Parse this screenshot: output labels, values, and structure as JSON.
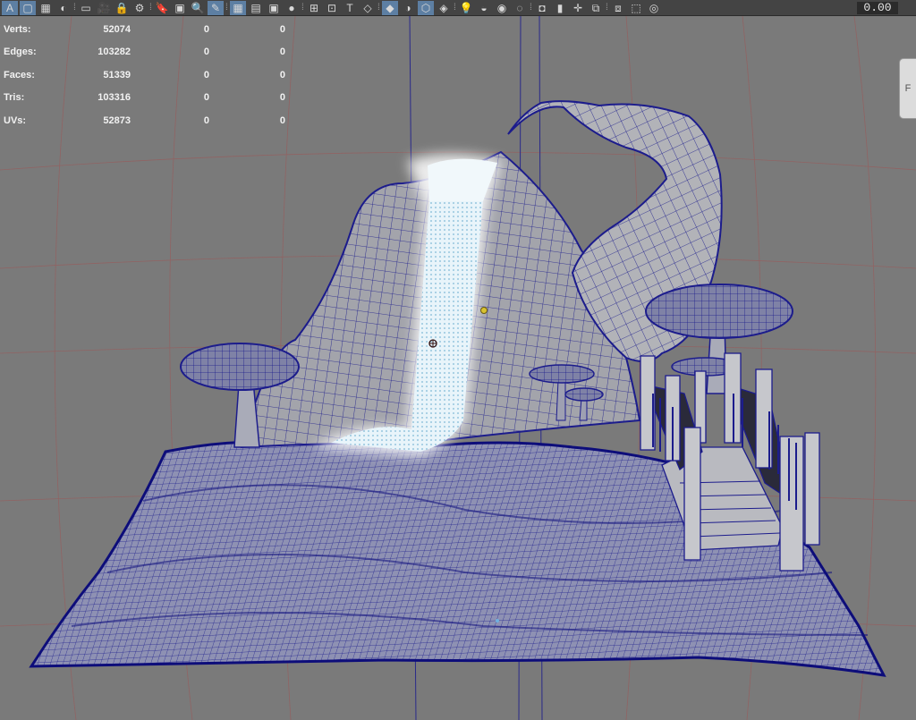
{
  "toolbar": {
    "icons": [
      {
        "name": "select-camera-icon",
        "glyph": "A",
        "active": true
      },
      {
        "name": "viewport-layout-icon",
        "glyph": "▢",
        "active": true
      },
      {
        "name": "panel-layout-icon",
        "glyph": "▦",
        "active": false
      },
      {
        "name": "ui-element-icon",
        "glyph": "◐",
        "active": false
      },
      {
        "name": "film-icon",
        "glyph": "▭",
        "active": false
      },
      {
        "name": "camera-icon",
        "glyph": "🎥",
        "active": false
      },
      {
        "name": "lock-camera-icon",
        "glyph": "🔒",
        "active": false
      },
      {
        "name": "camera-attributes-icon",
        "glyph": "⚙",
        "active": false
      },
      {
        "name": "bookmark-icon",
        "glyph": "🔖",
        "active": false
      },
      {
        "name": "image-plane-icon",
        "glyph": "▣",
        "active": false
      },
      {
        "name": "zoom-icon",
        "glyph": "🔍",
        "active": false
      },
      {
        "name": "grease-pencil-icon",
        "glyph": "✎",
        "active": true
      },
      {
        "name": "grid-icon",
        "glyph": "▦",
        "active": true
      },
      {
        "name": "film-gate-icon",
        "glyph": "▤",
        "active": false
      },
      {
        "name": "resolution-gate-icon",
        "glyph": "▣",
        "active": false
      },
      {
        "name": "gate-mask-icon",
        "glyph": "●",
        "active": false
      },
      {
        "name": "field-chart-icon",
        "glyph": "⊞",
        "active": false
      },
      {
        "name": "safe-action-icon",
        "glyph": "⊡",
        "active": false
      },
      {
        "name": "safe-title-icon",
        "glyph": "T",
        "active": false
      },
      {
        "name": "wireframe-icon",
        "glyph": "◇",
        "active": false
      },
      {
        "name": "smooth-shade-icon",
        "glyph": "◆",
        "active": true
      },
      {
        "name": "default-material-icon",
        "glyph": "◑",
        "active": false
      },
      {
        "name": "wireframe-on-shaded-icon",
        "glyph": "⬡",
        "active": true
      },
      {
        "name": "textured-icon",
        "glyph": "◈",
        "active": false
      },
      {
        "name": "lights-icon",
        "glyph": "💡",
        "active": false
      },
      {
        "name": "shadows-icon",
        "glyph": "◒",
        "active": false
      },
      {
        "name": "ambient-occlusion-icon",
        "glyph": "◉",
        "active": false
      },
      {
        "name": "motion-blur-icon",
        "glyph": "◌",
        "active": false
      },
      {
        "name": "anti-aliasing-icon",
        "glyph": "◘",
        "active": false
      },
      {
        "name": "isolate-select-icon",
        "glyph": "▮",
        "active": false
      },
      {
        "name": "xray-icon",
        "glyph": "✛",
        "active": false
      },
      {
        "name": "xray-joints-icon",
        "glyph": "⧉",
        "active": false
      },
      {
        "name": "xray-components-icon",
        "glyph": "⧈",
        "active": false
      },
      {
        "name": "backface-culling-icon",
        "glyph": "⬚",
        "active": false
      },
      {
        "name": "gamma-icon",
        "glyph": "◎",
        "active": false
      }
    ],
    "exposure_value": "0.00"
  },
  "stats": [
    {
      "label": "Verts:",
      "value": "52074",
      "sel": "0",
      "uv": "0"
    },
    {
      "label": "Edges:",
      "value": "103282",
      "sel": "0",
      "uv": "0"
    },
    {
      "label": "Faces:",
      "value": "51339",
      "sel": "0",
      "uv": "0"
    },
    {
      "label": "Tris:",
      "value": "103316",
      "sel": "0",
      "uv": "0"
    },
    {
      "label": "UVs:",
      "value": "52873",
      "sel": "0",
      "uv": "0"
    }
  ],
  "view_cube_label": "F",
  "colors": {
    "viewport_bg": "#7a7a7a",
    "wire": "#1c1c8c",
    "mesh_fill": "#9ea0a8",
    "ground_fill": "#8e91b3",
    "water": "#dff1fb",
    "grid_line": "#9a5a5a",
    "axis_line": "#2a2a8a"
  }
}
